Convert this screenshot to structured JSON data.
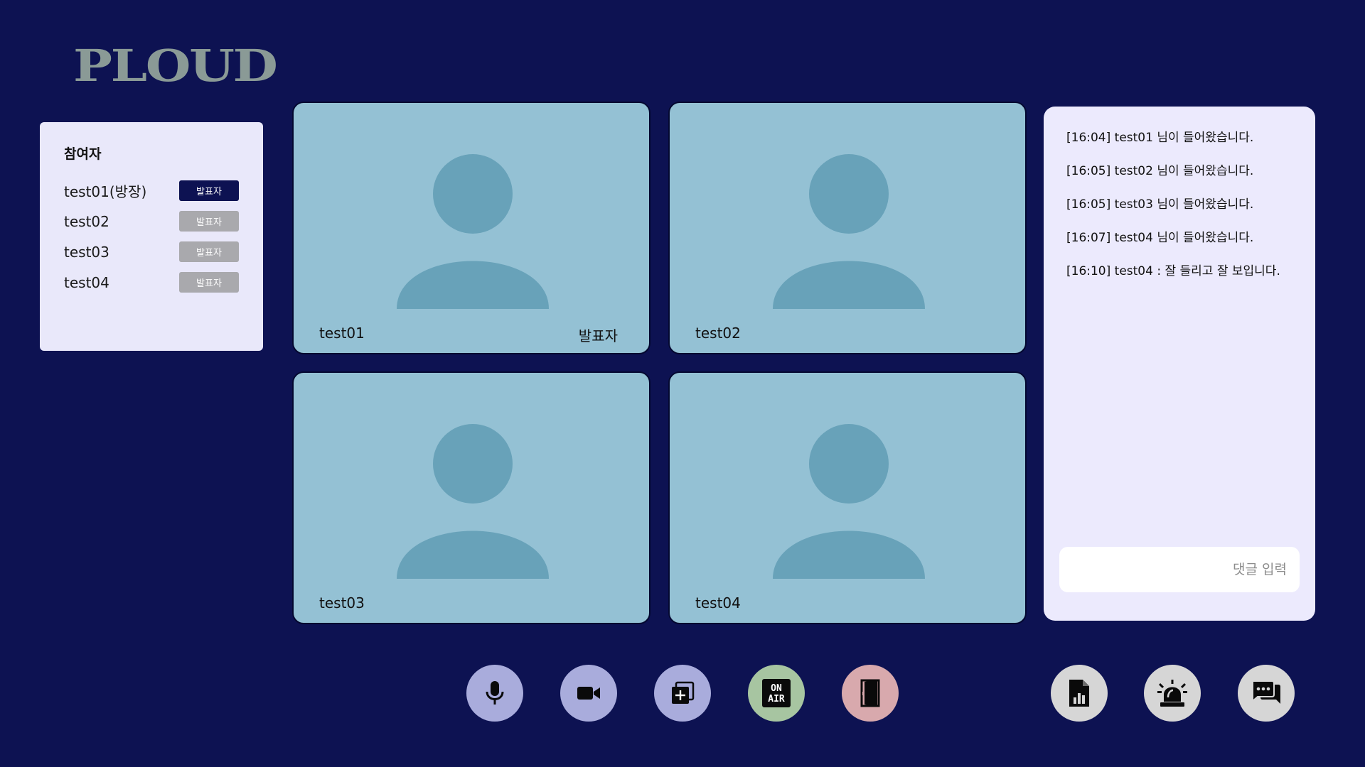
{
  "app": {
    "logo": "PLOUD"
  },
  "participants": {
    "title": "참여자",
    "items": [
      {
        "name": "test01(방장)",
        "badge": "발표자",
        "active": true
      },
      {
        "name": "test02",
        "badge": "발표자",
        "active": false
      },
      {
        "name": "test03",
        "badge": "발표자",
        "active": false
      },
      {
        "name": "test04",
        "badge": "발표자",
        "active": false
      }
    ]
  },
  "videos": [
    {
      "name": "test01",
      "role": "발표자"
    },
    {
      "name": "test02",
      "role": ""
    },
    {
      "name": "test03",
      "role": ""
    },
    {
      "name": "test04",
      "role": ""
    }
  ],
  "chat": {
    "messages": [
      "[16:04] test01 님이 들어왔습니다.",
      "[16:05] test02 님이 들어왔습니다.",
      "[16:05] test03 님이 들어왔습니다.",
      "[16:07] test04 님이 들어왔습니다.",
      "[16:10] test04 : 잘 들리고 잘 보입니다."
    ],
    "input_placeholder": "댓글 입력",
    "input_value": ""
  },
  "controls": {
    "left": [
      {
        "icon": "microphone-icon",
        "color": "#a9acdc"
      },
      {
        "icon": "video-camera-icon",
        "color": "#a9acdc"
      },
      {
        "icon": "add-screen-icon",
        "color": "#a9acdc"
      },
      {
        "icon": "on-air-icon",
        "color": "#a7c5a1",
        "text_top": "ON",
        "text_bottom": "AIR"
      },
      {
        "icon": "exit-door-icon",
        "color": "#d8a9ad"
      }
    ],
    "right": [
      {
        "icon": "report-chart-icon",
        "color": "#d6d6d6"
      },
      {
        "icon": "siren-alert-icon",
        "color": "#d6d6d6"
      },
      {
        "icon": "chat-bubbles-icon",
        "color": "#d6d6d6"
      }
    ]
  }
}
